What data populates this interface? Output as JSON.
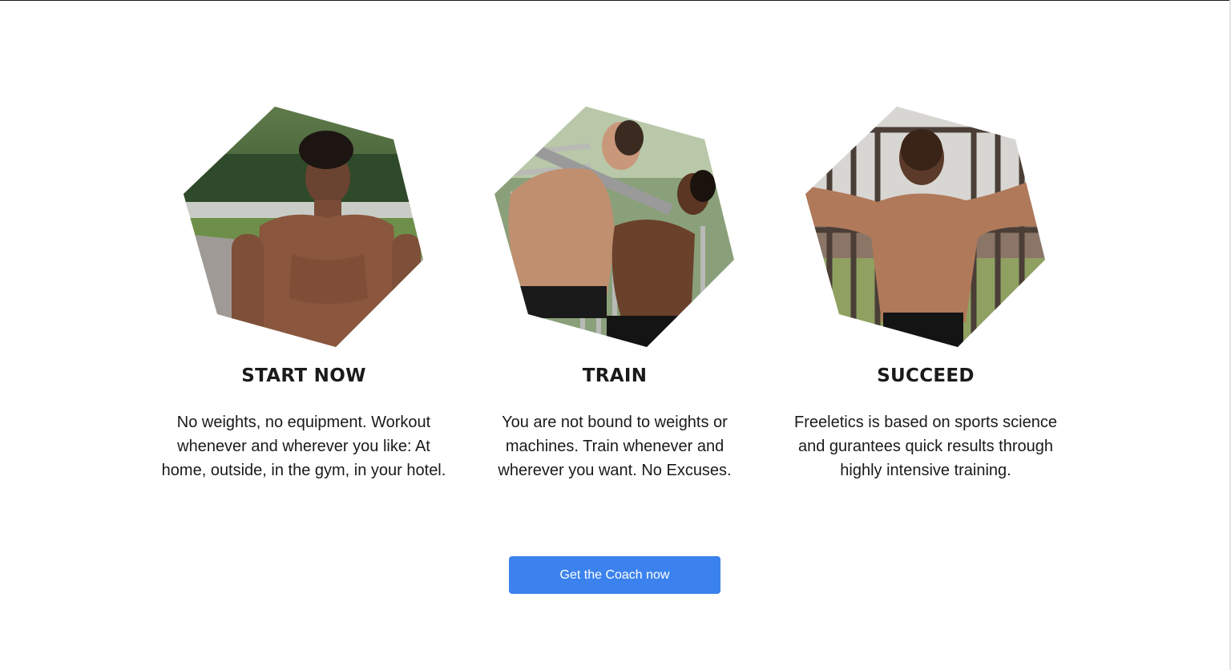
{
  "features": [
    {
      "title": "START NOW",
      "text": "No weights, no equipment. Workout whenever and wherever you like: At home, outside, in the gym, in your hotel.",
      "image": "athlete-standing-outdoors"
    },
    {
      "title": "TRAIN",
      "text": "You are not bound to weights or machines. Train whenever and wherever you want. No Excuses.",
      "image": "athletes-doing-pull-ups"
    },
    {
      "title": "SUCCEED",
      "text": "Freeletics is based on sports science and gurantees quick results through highly intensive training.",
      "image": "athlete-back-on-bars"
    }
  ],
  "cta": {
    "label": "Get the Coach now"
  },
  "colors": {
    "accent": "#3b82ee",
    "text": "#1a1a1a",
    "background": "#ffffff"
  }
}
